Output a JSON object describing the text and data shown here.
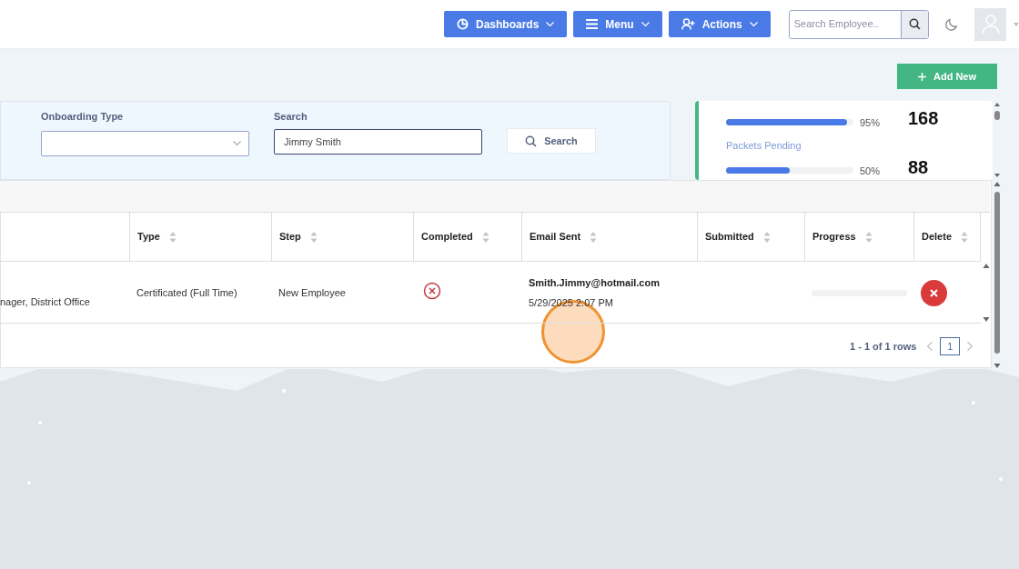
{
  "header": {
    "buttons": [
      {
        "label": "Dashboards"
      },
      {
        "label": "Menu"
      },
      {
        "label": "Actions"
      }
    ],
    "search": {
      "placeholder": "Search Employee.."
    }
  },
  "add_button": {
    "label": "Add New"
  },
  "filters": {
    "onboarding_type": {
      "label": "Onboarding Type"
    },
    "search": {
      "label": "Search",
      "value": "Jimmy Smith"
    },
    "search_button": "Search"
  },
  "stats": [
    {
      "level": 0.95,
      "percent": "95%",
      "count": "168",
      "caption": "Packets Pending"
    },
    {
      "level": 0.5,
      "percent": "50%",
      "count": "88"
    }
  ],
  "table": {
    "columns": [
      "",
      "Type",
      "Step",
      "Completed",
      "Email Sent",
      "Submitted",
      "Progress",
      "Delete"
    ],
    "rows": [
      {
        "column_1": "nager, District Office",
        "type": "Certificated (Full Time)",
        "step": "New Employee",
        "completed": false,
        "email": "Smith.Jimmy@hotmail.com",
        "email_date": "5/29/2025 2:07 PM",
        "level": 0
      }
    ]
  },
  "pagination": {
    "summary": "1 - 1 of 1 rows",
    "pages": [
      {
        "label": "1",
        "selected": true
      }
    ]
  }
}
